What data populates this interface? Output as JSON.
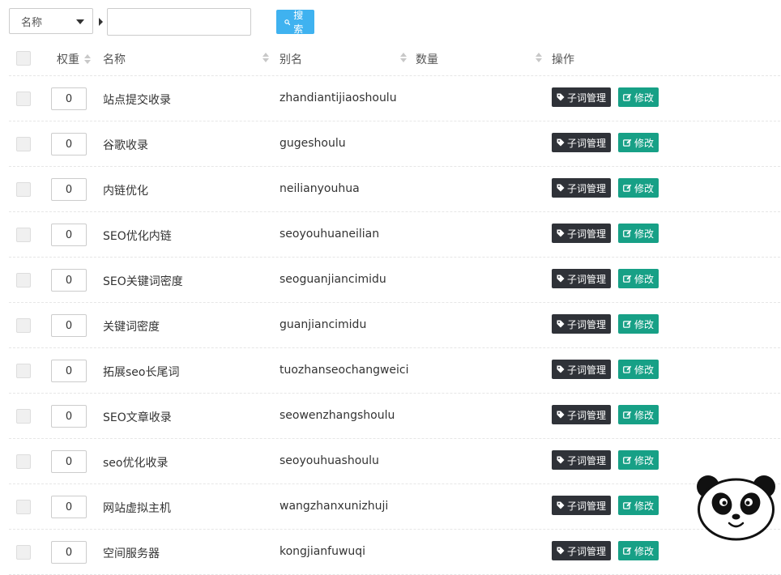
{
  "toolbar": {
    "select_value": "名称",
    "search_value": "",
    "search_button": "搜索"
  },
  "table": {
    "headers": {
      "weight": "权重",
      "name": "名称",
      "alias": "别名",
      "count": "数量",
      "actions": "操作"
    },
    "action_labels": {
      "manage": "子词管理",
      "edit": "修改"
    },
    "rows": [
      {
        "weight": "0",
        "name": "站点提交收录",
        "alias": "zhandiantijiaoshoulu"
      },
      {
        "weight": "0",
        "name": "谷歌收录",
        "alias": "gugeshoulu"
      },
      {
        "weight": "0",
        "name": "内链优化",
        "alias": "neilianyouhua"
      },
      {
        "weight": "0",
        "name": "SEO优化内链",
        "alias": "seoyouhuaneilian"
      },
      {
        "weight": "0",
        "name": "SEO关键词密度",
        "alias": "seoguanjiancimidu"
      },
      {
        "weight": "0",
        "name": "关键词密度",
        "alias": "guanjiancimidu"
      },
      {
        "weight": "0",
        "name": "拓展seo长尾词",
        "alias": "tuozhanseochangweici"
      },
      {
        "weight": "0",
        "name": "SEO文章收录",
        "alias": "seowenzhangshoulu"
      },
      {
        "weight": "0",
        "name": "seo优化收录",
        "alias": "seoyouhuashoulu"
      },
      {
        "weight": "0",
        "name": "网站虚拟主机",
        "alias": "wangzhanxunizhuji"
      },
      {
        "weight": "0",
        "name": "空间服务器",
        "alias": "kongjianfuwuqi"
      }
    ]
  },
  "colors": {
    "search_button": "#3fb2f0",
    "manage_button": "#2f3238",
    "edit_button": "#17a086"
  },
  "icons": [
    "search-icon",
    "tag-icon",
    "edit-icon",
    "panda-mascot-icon"
  ]
}
